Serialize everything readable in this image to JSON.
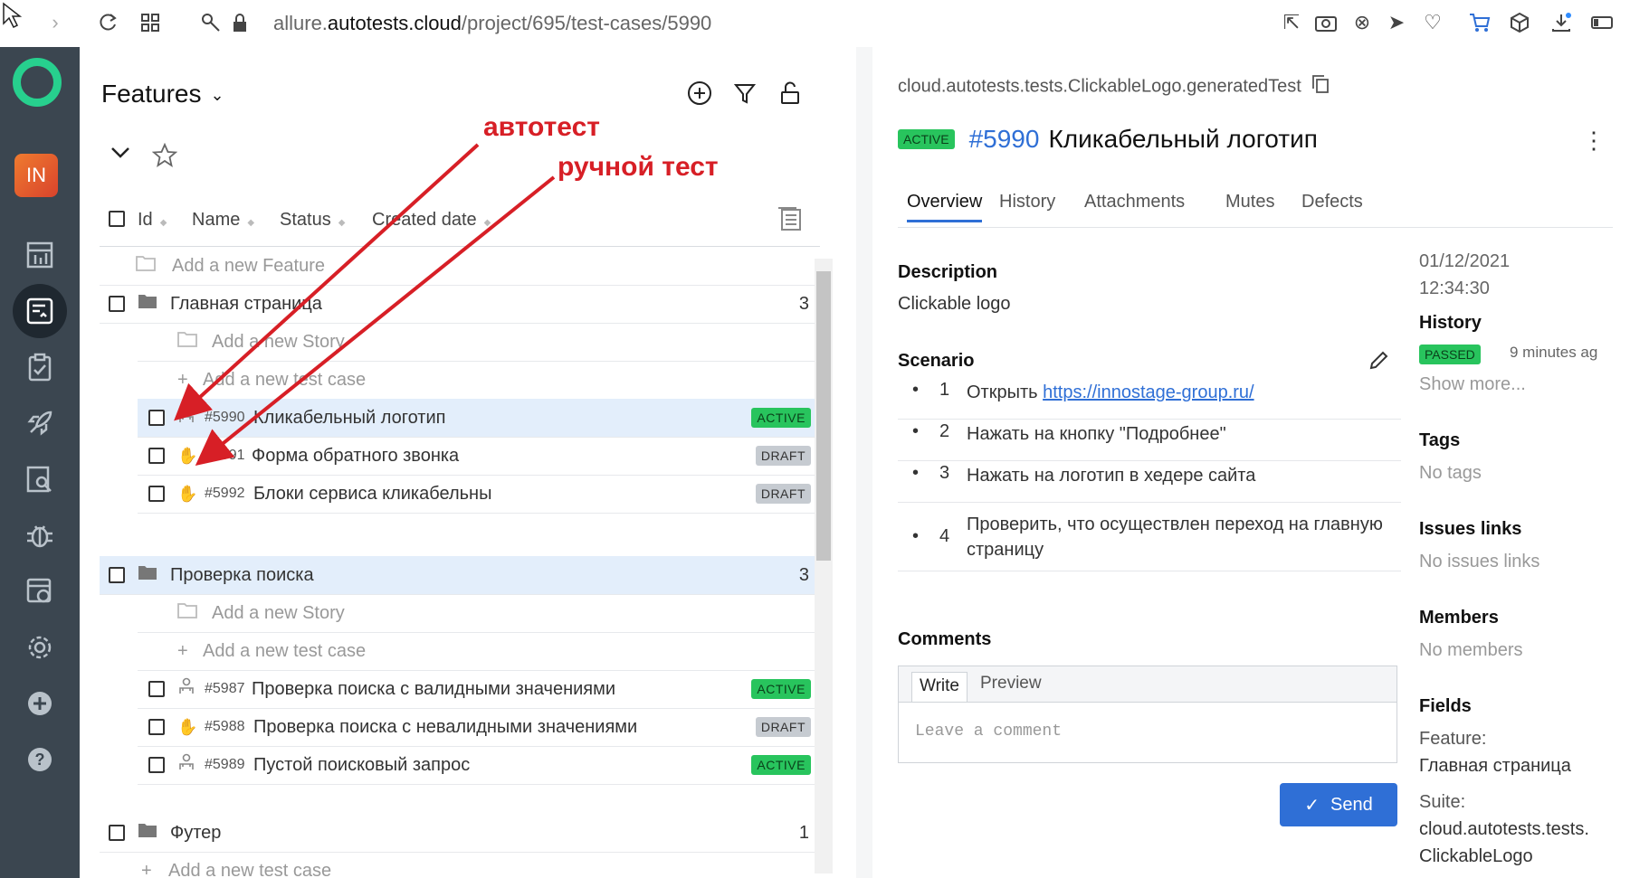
{
  "browser": {
    "url_prefix": "allure.",
    "url_domain": "autotests.cloud",
    "url_path": "/project/695/test-cases/5990"
  },
  "sidebar": {
    "avatar": "IN",
    "items": [
      "dashboard",
      "test-cases",
      "test-plans",
      "launches",
      "analytics",
      "defects",
      "jobs",
      "settings",
      "add",
      "help"
    ]
  },
  "tree": {
    "title": "Features",
    "columns": {
      "id": "Id",
      "name": "Name",
      "status": "Status",
      "created": "Created date"
    },
    "add_feature": "Add a new Feature",
    "add_story": "Add a new Story",
    "add_test_case": "Add a new test case",
    "groups": [
      {
        "name": "Главная страница",
        "count": "3",
        "cases": [
          {
            "id": "#5990",
            "name": "Кликабельный логотип",
            "status": "ACTIVE",
            "kind": "auto"
          },
          {
            "id": "#5991",
            "name": "Форма обратного звонка",
            "status": "DRAFT",
            "kind": "manual"
          },
          {
            "id": "#5992",
            "name": "Блоки сервиса кликабельны",
            "status": "DRAFT",
            "kind": "manual"
          }
        ]
      },
      {
        "name": "Проверка поиска",
        "count": "3",
        "cases": [
          {
            "id": "#5987",
            "name": "Проверка поиска с валидными значениями",
            "status": "ACTIVE",
            "kind": "auto"
          },
          {
            "id": "#5988",
            "name": "Проверка поиска с невалидными значениями",
            "status": "DRAFT",
            "kind": "manual"
          },
          {
            "id": "#5989",
            "name": "Пустой поисковый запрос",
            "status": "ACTIVE",
            "kind": "auto"
          }
        ]
      },
      {
        "name": "Футер",
        "count": "1",
        "cases": []
      }
    ]
  },
  "detail": {
    "path": "cloud.autotests.tests.ClickableLogo.generatedTest",
    "status": "ACTIVE",
    "number": "#5990",
    "title": "Кликабельный логотип",
    "tabs": [
      "Overview",
      "History",
      "Attachments",
      "Mutes",
      "Defects"
    ],
    "description_label": "Description",
    "description": "Clickable logo",
    "scenario_label": "Scenario",
    "steps": [
      {
        "n": "1",
        "text": "Открыть ",
        "link": "https://innostage-group.ru/"
      },
      {
        "n": "2",
        "text": "Нажать на кнопку \"Подробнее\""
      },
      {
        "n": "3",
        "text": "Нажать на логотип в хедере сайта"
      },
      {
        "n": "4",
        "text": "Проверить, что осуществлен переход на главную",
        "text2": "страницу"
      }
    ],
    "date": "01/12/2021",
    "time": "12:34:30",
    "history_label": "History",
    "history_status": "PASSED",
    "history_ago": "9 minutes ag",
    "show_more": "Show more...",
    "tags_label": "Tags",
    "tags_value": "No tags",
    "issues_label": "Issues links",
    "issues_value": "No issues links",
    "members_label": "Members",
    "members_value": "No members",
    "fields_label": "Fields",
    "feature_label": "Feature:",
    "feature_value": "Главная страница",
    "suite_label": "Suite:",
    "suite_value1": "cloud.autotests.tests.",
    "suite_value2": "ClickableLogo",
    "comments_label": "Comments",
    "write_tab": "Write",
    "preview_tab": "Preview",
    "comment_placeholder": "Leave a comment",
    "send_label": "Send"
  },
  "annotations": {
    "auto": "автотест",
    "manual": "ручной тест"
  },
  "colors": {
    "accent": "#2f6fd6",
    "active": "#28c45d",
    "annotation": "#d71f26",
    "sidebar": "#3b4650"
  }
}
